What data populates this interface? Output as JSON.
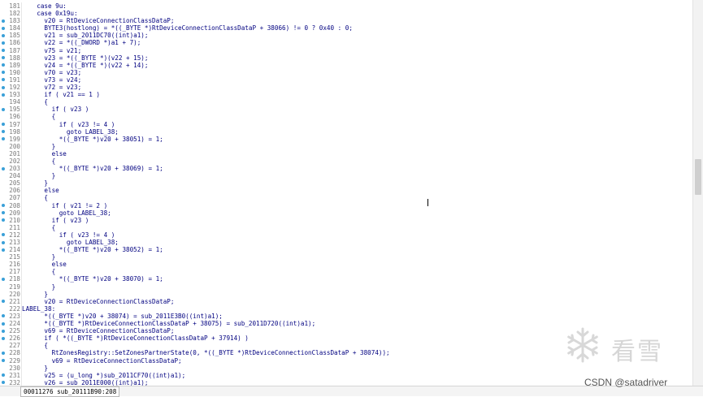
{
  "editor": {
    "lines": [
      {
        "n": "181",
        "dot": false,
        "t": "    case 9u:"
      },
      {
        "n": "182",
        "dot": false,
        "t": "    case 0x19u:"
      },
      {
        "n": "183",
        "dot": true,
        "t": "      v20 = RtDeviceConnectionClassDataP;"
      },
      {
        "n": "184",
        "dot": true,
        "t": "      BYTE3(hostlong) = *((_BYTE *)RtDeviceConnectionClassDataP + 38066) != 0 ? 0x40 : 0;"
      },
      {
        "n": "185",
        "dot": true,
        "t": "      v21 = sub_2011DC70((int)a1);"
      },
      {
        "n": "186",
        "dot": true,
        "t": "      v22 = *((_DWORD *)a1 + 7);"
      },
      {
        "n": "187",
        "dot": true,
        "t": "      v75 = v21;"
      },
      {
        "n": "188",
        "dot": true,
        "t": "      v23 = *((_BYTE *)(v22 + 15);"
      },
      {
        "n": "189",
        "dot": true,
        "t": "      v24 = *((_BYTE *)(v22 + 14);"
      },
      {
        "n": "190",
        "dot": true,
        "t": "      v70 = v23;"
      },
      {
        "n": "191",
        "dot": true,
        "t": "      v73 = v24;"
      },
      {
        "n": "192",
        "dot": true,
        "t": "      v72 = v23;"
      },
      {
        "n": "193",
        "dot": true,
        "t": "      if ( v21 == 1 )"
      },
      {
        "n": "194",
        "dot": false,
        "t": "      {"
      },
      {
        "n": "195",
        "dot": true,
        "t": "        if ( v23 )"
      },
      {
        "n": "196",
        "dot": false,
        "t": "        {"
      },
      {
        "n": "197",
        "dot": true,
        "t": "          if ( v23 != 4 )"
      },
      {
        "n": "198",
        "dot": true,
        "t": "            goto LABEL_38;"
      },
      {
        "n": "199",
        "dot": true,
        "t": "          *((_BYTE *)v20 + 38051) = 1;"
      },
      {
        "n": "200",
        "dot": false,
        "t": "        }"
      },
      {
        "n": "201",
        "dot": false,
        "t": "        else"
      },
      {
        "n": "202",
        "dot": false,
        "t": "        {"
      },
      {
        "n": "203",
        "dot": true,
        "t": "          *((_BYTE *)v20 + 38069) = 1;"
      },
      {
        "n": "204",
        "dot": false,
        "t": "        }"
      },
      {
        "n": "205",
        "dot": false,
        "t": "      }"
      },
      {
        "n": "206",
        "dot": false,
        "t": "      else"
      },
      {
        "n": "207",
        "dot": false,
        "t": "      {"
      },
      {
        "n": "208",
        "dot": true,
        "t": "        if ( v21 != 2 )"
      },
      {
        "n": "209",
        "dot": true,
        "t": "          goto LABEL_38;"
      },
      {
        "n": "210",
        "dot": true,
        "t": "        if ( v23 )"
      },
      {
        "n": "211",
        "dot": false,
        "t": "        {"
      },
      {
        "n": "212",
        "dot": true,
        "t": "          if ( v23 != 4 )"
      },
      {
        "n": "213",
        "dot": true,
        "t": "            goto LABEL_38;"
      },
      {
        "n": "214",
        "dot": true,
        "t": "          *((_BYTE *)v20 + 38052) = 1;"
      },
      {
        "n": "215",
        "dot": false,
        "t": "        }"
      },
      {
        "n": "216",
        "dot": false,
        "t": "        else"
      },
      {
        "n": "217",
        "dot": false,
        "t": "        {"
      },
      {
        "n": "218",
        "dot": true,
        "t": "          *((_BYTE *)v20 + 38070) = 1;"
      },
      {
        "n": "219",
        "dot": false,
        "t": "        }"
      },
      {
        "n": "220",
        "dot": false,
        "t": "      }"
      },
      {
        "n": "221",
        "dot": true,
        "t": "      v20 = RtDeviceConnectionClassDataP;"
      },
      {
        "n": "222",
        "dot": false,
        "t": "LABEL_38:"
      },
      {
        "n": "223",
        "dot": true,
        "t": "      *((_BYTE *)v20 + 38074) = sub_2011E3B0((int)a1);"
      },
      {
        "n": "224",
        "dot": true,
        "t": "      *((_BYTE *)RtDeviceConnectionClassDataP + 38075) = sub_2011D720((int)a1);"
      },
      {
        "n": "225",
        "dot": true,
        "t": "      v69 = RtDeviceConnectionClassDataP;"
      },
      {
        "n": "226",
        "dot": true,
        "t": "      if ( *((_BYTE *)RtDeviceConnectionClassDataP + 37914) )"
      },
      {
        "n": "227",
        "dot": false,
        "t": "      {"
      },
      {
        "n": "228",
        "dot": true,
        "t": "        RtZonesRegistry::SetZonesPartnerState(0, *((_BYTE *)RtDeviceConnectionClassDataP + 38074));"
      },
      {
        "n": "229",
        "dot": true,
        "t": "        v69 = RtDeviceConnectionClassDataP;"
      },
      {
        "n": "230",
        "dot": false,
        "t": "      }"
      },
      {
        "n": "231",
        "dot": true,
        "t": "      v25 = (u_long *)sub_2011CF70((int)a1);"
      },
      {
        "n": "232",
        "dot": true,
        "t": "      v26 = sub_2011E000((int)a1);"
      }
    ]
  },
  "status": {
    "text": "00011276 sub_20111B90:208"
  },
  "watermark": {
    "brand_text": "看雪",
    "csdn_text": "CSDN @satadriver"
  },
  "colors": {
    "code_text": "#000080",
    "line_number": "#7a7a7a",
    "breakpoint_dot": "#3aa0d8",
    "background": "#ffffff"
  }
}
